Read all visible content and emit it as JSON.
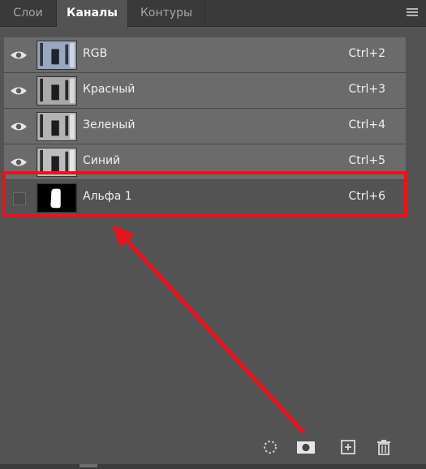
{
  "tabs": [
    {
      "label": "Слои",
      "active": false
    },
    {
      "label": "Каналы",
      "active": true
    },
    {
      "label": "Контуры",
      "active": false
    }
  ],
  "channels": [
    {
      "name": "RGB",
      "shortcut": "Ctrl+2",
      "visible": true,
      "thumbnail": "rgb-photo"
    },
    {
      "name": "Красный",
      "shortcut": "Ctrl+3",
      "visible": true,
      "thumbnail": "red-photo"
    },
    {
      "name": "Зеленый",
      "shortcut": "Ctrl+4",
      "visible": true,
      "thumbnail": "green-photo"
    },
    {
      "name": "Синий",
      "shortcut": "Ctrl+5",
      "visible": true,
      "thumbnail": "blue-photo"
    },
    {
      "name": "Альфа 1",
      "shortcut": "Ctrl+6",
      "visible": false,
      "thumbnail": "alpha-mask"
    }
  ],
  "footer_tools": [
    "load-selection-icon",
    "save-selection-icon",
    "new-channel-icon",
    "delete-channel-icon"
  ],
  "annotation": {
    "color": "#e8141c",
    "target": "Альфа 1"
  }
}
